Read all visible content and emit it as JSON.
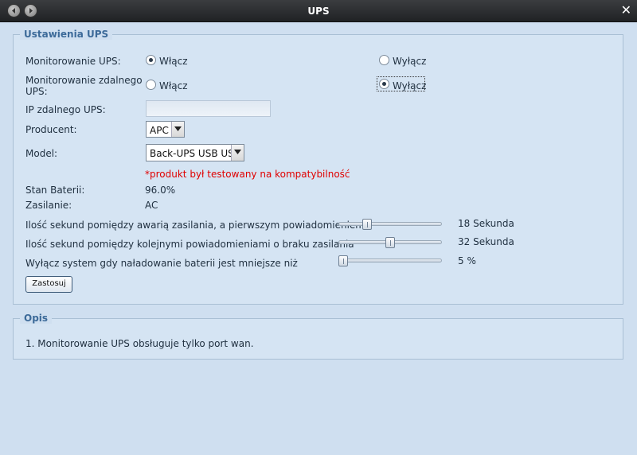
{
  "window": {
    "title": "UPS"
  },
  "settings": {
    "legend": "Ustawienia UPS",
    "ups_monitoring": {
      "label": "Monitorowanie UPS:",
      "on": "Włącz",
      "off": "Wyłącz",
      "selected": "on"
    },
    "remote_monitoring": {
      "label_line1": "Monitorowanie zdalnego",
      "label_line2": "UPS:",
      "on": "Włącz",
      "off": "Wyłącz",
      "selected": "off"
    },
    "remote_ip": {
      "label": "IP zdalnego UPS:",
      "value": ""
    },
    "vendor": {
      "label": "Producent:",
      "value": "APC"
    },
    "model": {
      "label": "Model:",
      "value": "Back-UPS USB USB"
    },
    "tested_note": "*produkt był testowany na kompatybilność",
    "battery": {
      "label": "Stan Baterii:",
      "value": "96.0%"
    },
    "power": {
      "label": "Zasilanie:",
      "value": "AC"
    },
    "sliders": [
      {
        "label": "Ilość sekund pomiędzy awarią zasilania, a pierwszym powiadomieniem",
        "value_text": "18 Sekunda",
        "fraction": 0.25
      },
      {
        "label": "Ilość sekund pomiędzy kolejnymi powiadomieniami o braku zasilania",
        "value_text": "32 Sekunda",
        "fraction": 0.5
      },
      {
        "label": "Wyłącz system gdy naładowanie baterii jest mniejsze niż",
        "value_text": "5 %",
        "fraction": 0.0
      }
    ],
    "apply_label": "Zastosuj"
  },
  "description": {
    "legend": "Opis",
    "text": "1. Monitorowanie UPS obsługuje tylko port wan."
  }
}
